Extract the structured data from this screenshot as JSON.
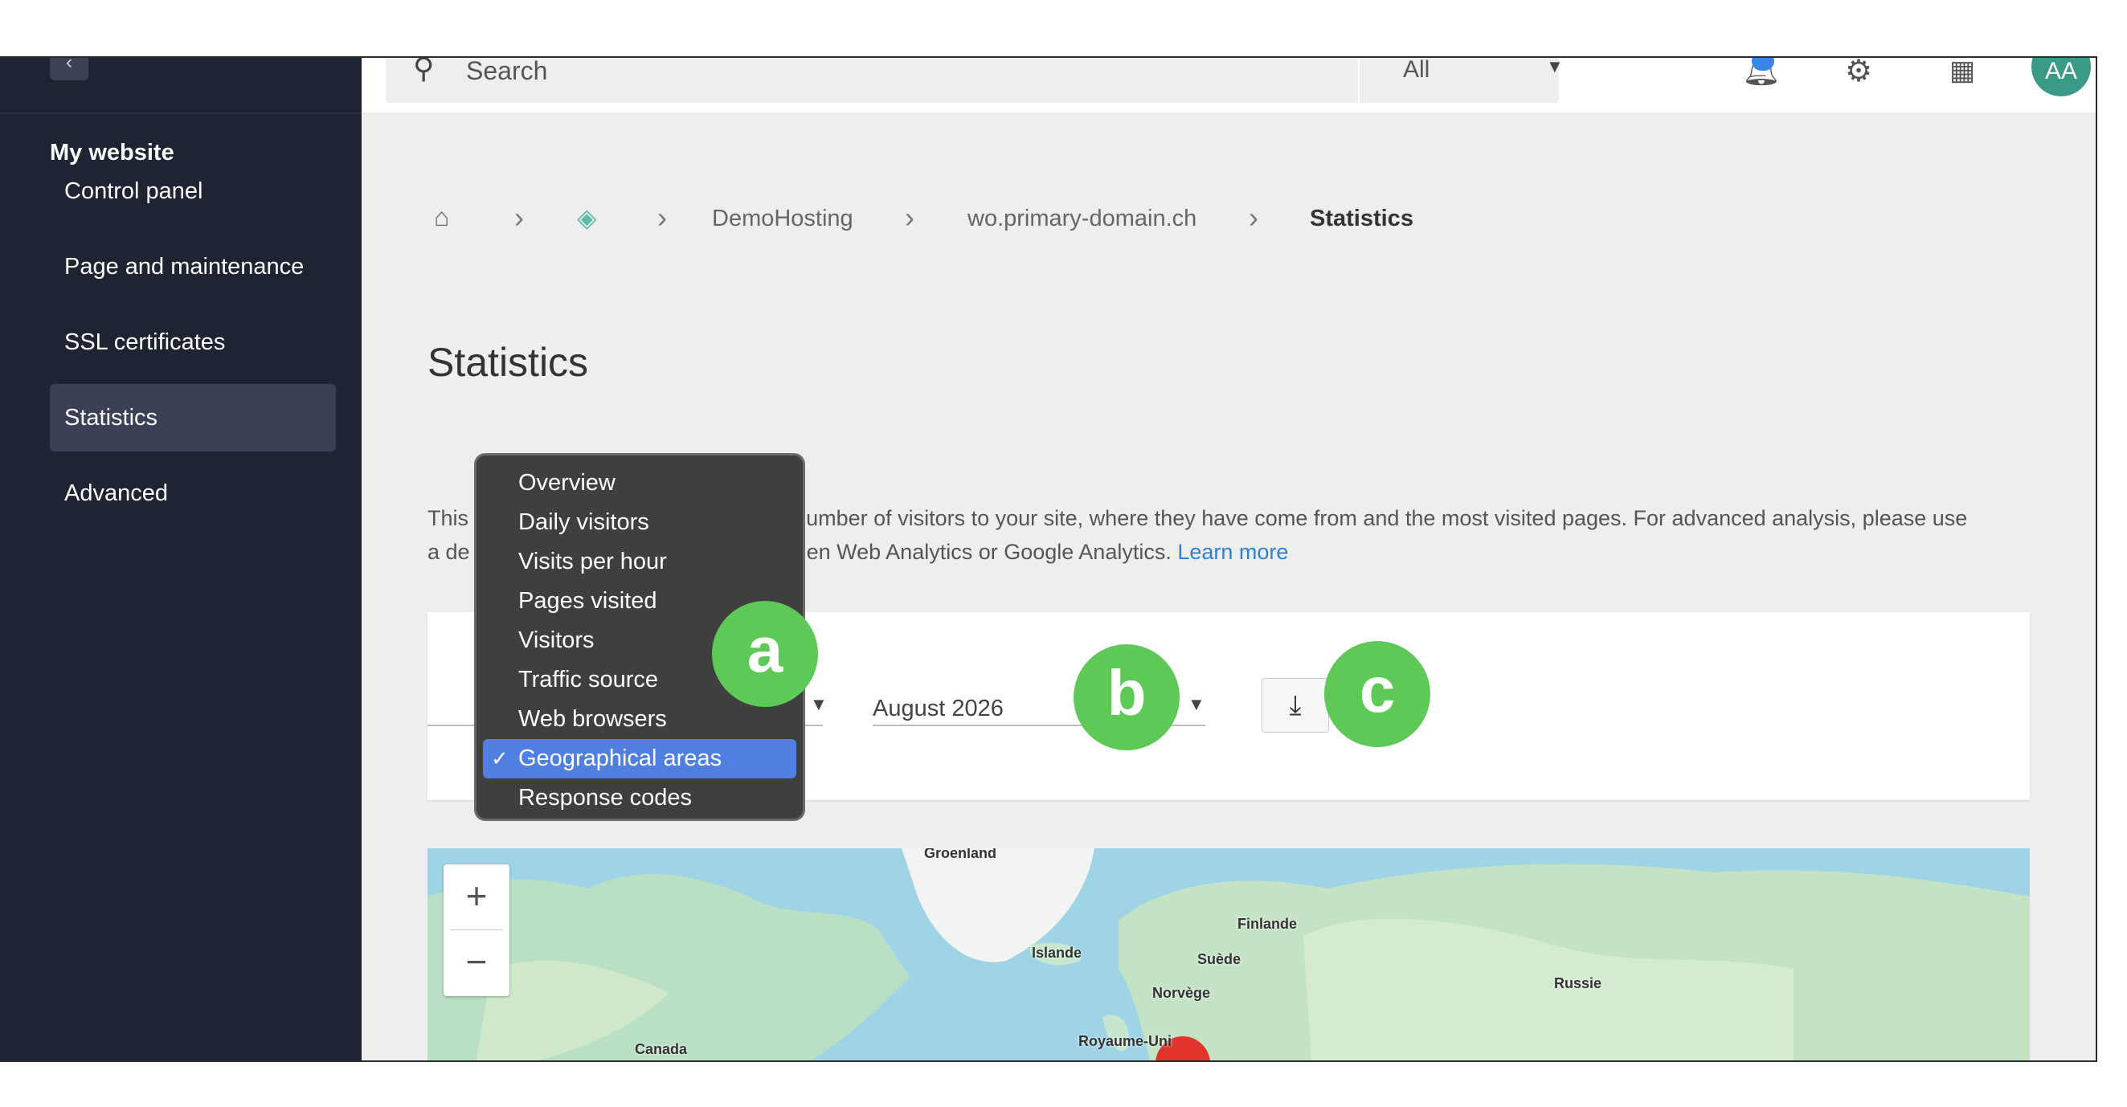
{
  "sidebar": {
    "back_glyph": "‹",
    "section_title": "My website",
    "items": [
      {
        "label": "Control panel"
      },
      {
        "label": "Page and maintenance"
      },
      {
        "label": "SSL certificates"
      },
      {
        "label": "Statistics",
        "active": true
      },
      {
        "label": "Advanced"
      }
    ]
  },
  "topbar": {
    "search_placeholder": "Search",
    "scope": "All",
    "avatar_initials": "AA",
    "icons": [
      "search-icon",
      "bell-icon",
      "gear-icon",
      "apps-grid-icon"
    ]
  },
  "breadcrumb": {
    "items": [
      "DemoHosting",
      "wo.primary-domain.ch"
    ],
    "current": "Statistics"
  },
  "page": {
    "title": "Statistics",
    "description_start": "This",
    "description_mid": "number of visitors to your site, where they have come from and the most visited pages. For advanced analysis, please use",
    "description_line2_start": "a de",
    "description_line2_mid": "en Web Analytics or Google Analytics.",
    "learn_more": "Learn more"
  },
  "filters": {
    "report_options": [
      "Overview",
      "Daily visitors",
      "Visits per hour",
      "Pages visited",
      "Visitors",
      "Traffic source",
      "Web browsers",
      "Geographical areas",
      "Response codes"
    ],
    "selected_report": "Geographical areas",
    "month": "August 2026",
    "download_glyph": "⤓"
  },
  "map": {
    "zoom_in": "+",
    "zoom_out": "−",
    "labels": [
      "Groenland",
      "Finlande",
      "Islande",
      "Suède",
      "Norvège",
      "Russie",
      "Royaume-Uni",
      "Canada"
    ]
  },
  "callouts": [
    "a",
    "b",
    "c"
  ],
  "colors": {
    "sidebar_bg": "#1f2433",
    "accent_blue": "#4f7fe0",
    "callout_green": "#5ec957",
    "avatar_teal": "#3a9a85"
  }
}
